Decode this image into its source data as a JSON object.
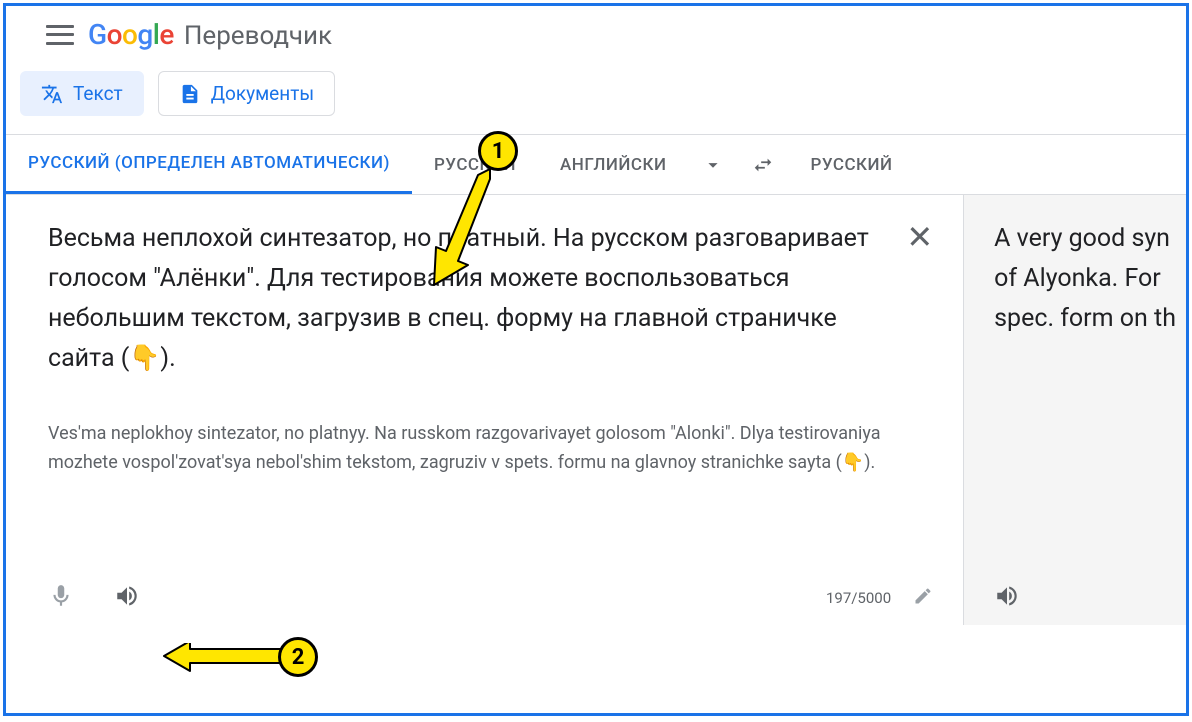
{
  "header": {
    "app_name": "Переводчик"
  },
  "modes": {
    "text": "Текст",
    "documents": "Документы"
  },
  "langs": {
    "src_detected": "РУССКИЙ (ОПРЕДЕЛЕН АВТОМАТИЧЕСКИ)",
    "src_ru": "РУССКИЙ",
    "src_en": "АНГЛИЙСКИ",
    "tgt_ru": "РУССКИЙ"
  },
  "source": {
    "text": "Весьма неплохой синтезатор, но платный. На русском разговаривает голосом \"Алёнки\". Для тестирования можете воспользоваться небольшим текстом, загрузив в спец. форму на главной страничке сайта (👇).",
    "translit": "Ves'ma neplokhoy sintezator, no platnyy. Na russkom razgovarivayet golosom \"Alonki\". Dlya testirovaniya mozhete vospol'zovat'sya nebol'shim tekstom, zagruziv v spets. formu na glavnoy stranichke sayta (👇).",
    "char_count": "197/5000"
  },
  "target": {
    "line1": "A very good syn",
    "line2": "of Alyonka. For",
    "line3": "spec. form on th"
  },
  "markers": {
    "one": "1",
    "two": "2"
  }
}
